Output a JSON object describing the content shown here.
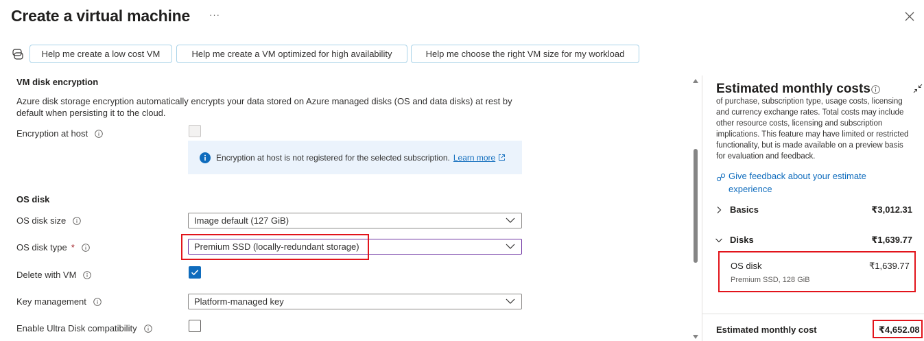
{
  "header": {
    "title": "Create a virtual machine",
    "more_label": "···"
  },
  "helpers": [
    {
      "label": "Help me create a low cost VM"
    },
    {
      "label": "Help me create a VM optimized for high availability"
    },
    {
      "label": "Help me choose the right VM size for my workload"
    }
  ],
  "encryption": {
    "heading": "VM disk encryption",
    "description": "Azure disk storage encryption automatically encrypts your data stored on Azure managed disks (OS and data disks) at rest by default when persisting it to the cloud.",
    "host_label": "Encryption at host",
    "host_checked": false,
    "host_disabled": true,
    "info_text": "Encryption at host is not registered for the selected subscription.",
    "learn_more": "Learn more"
  },
  "os_disk": {
    "heading": "OS disk",
    "size_label": "OS disk size",
    "size_value": "Image default (127 GiB)",
    "type_label": "OS disk type",
    "type_required": "*",
    "type_value": "Premium SSD (locally-redundant storage)",
    "delete_label": "Delete with VM",
    "delete_checked": true,
    "key_label": "Key management",
    "key_value": "Platform-managed key",
    "ultra_label": "Enable Ultra Disk compatibility",
    "ultra_checked": false
  },
  "costs": {
    "title": "Estimated monthly costs",
    "disclaimer": "of purchase, subscription type, usage costs, licensing and currency exchange rates. Total costs may include other resource costs, licensing and subscription implications. This feature may have limited or restricted functionality, but is made available on a preview basis for evaluation and feedback.",
    "feedback_link": "Give feedback about your estimate experience",
    "basics_label": "Basics",
    "basics_amount": "₹3,012.31",
    "disks_label": "Disks",
    "disks_amount": "₹1,639.77",
    "os_disk_label": "OS disk",
    "os_disk_amount": "₹1,639.77",
    "os_disk_detail": "Premium SSD, 128 GiB",
    "total_label": "Estimated monthly cost",
    "total_amount": "₹4,652.08"
  },
  "colors": {
    "accent": "#0f6cbd",
    "highlight_red": "#e2141b",
    "info_bg": "#ebf3fc"
  }
}
